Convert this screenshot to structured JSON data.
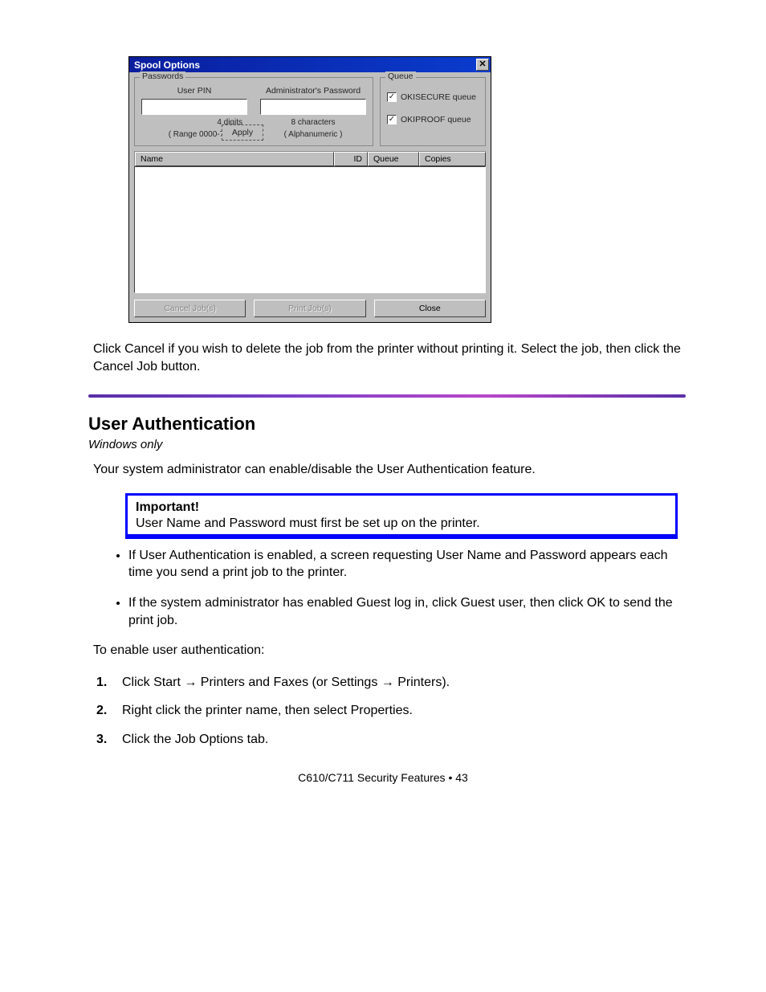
{
  "dialog": {
    "title": "Spool Options",
    "close_glyph": "✕",
    "passwords": {
      "group_title": "Passwords",
      "user_pin_label": "User PIN",
      "admin_pw_label": "Administrator's Password",
      "user_hint1": "4 digits",
      "user_hint2": "( Range 0000-7777 )",
      "admin_hint1": "8 characters",
      "admin_hint2": "( Alphanumeric )",
      "apply_label": "Apply"
    },
    "queue": {
      "group_title": "Queue",
      "okisecure_label": "OKISECURE queue",
      "okiproof_label": "OKIPROOF queue",
      "check_glyph": "✓"
    },
    "list": {
      "col_name": "Name",
      "col_id": "ID",
      "col_queue": "Queue",
      "col_copies": "Copies"
    },
    "buttons": {
      "cancel_jobs": "Cancel Job(s)",
      "print_jobs": "Print Job(s)",
      "close": "Close"
    }
  },
  "paragraphs": {
    "p_cancel": "Click Cancel if you wish to delete the job from the printer without printing it. Select the job, then click the Cancel Job button.",
    "h_section": "User Authentication",
    "h_sub": "Windows only",
    "p_intro": "Your system administrator can enable/disable the User Authentication feature.",
    "tip_title": "Important!",
    "tip_body": "User Name and Password must first be set up on the printer.",
    "bullet1": "If User Authentication is enabled, a screen requesting User Name and Password appears each time you send a print job to the printer.",
    "bullet2": "If the system administrator has enabled Guest log in, click Guest user, then click OK to send the print job.",
    "p_enable": "To enable user authentication:",
    "step1_num": "1.",
    "step1_text": "Click Start → Printers and Faxes (or Settings → Printers).",
    "step2_num": "2.",
    "step2_text": "Right click the printer name, then select Properties.",
    "step3_num": "3.",
    "step3_text": "Click the Job Options tab."
  },
  "footer": {
    "product": "C610/C711 Security Features • ",
    "page": "43"
  }
}
